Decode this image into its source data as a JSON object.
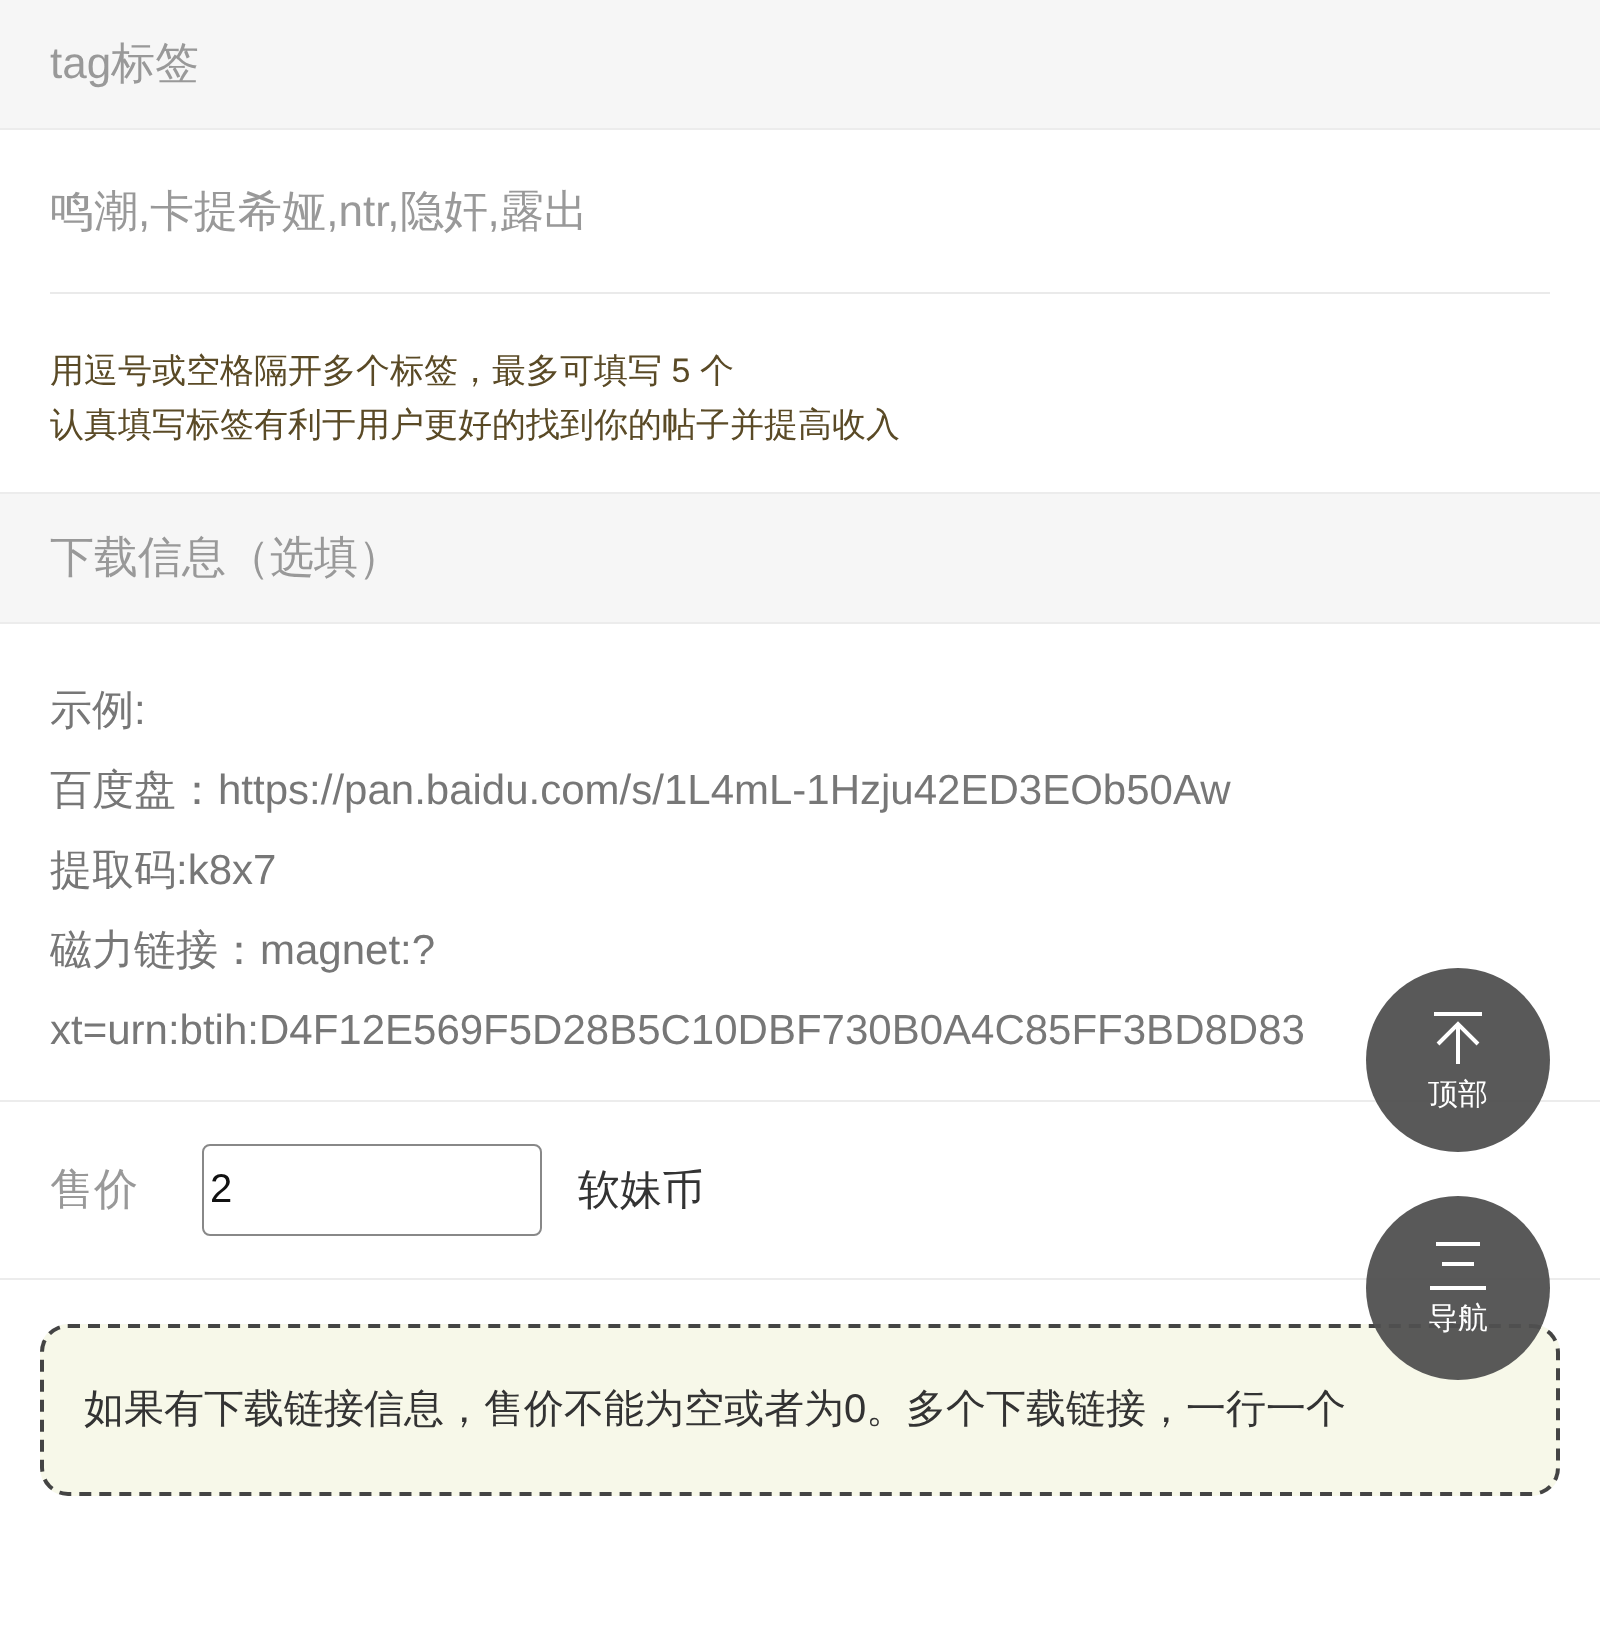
{
  "tag_section": {
    "title": "tag标签",
    "field": {
      "value": "鸣潮,卡提希娅,ntr,隐奸,露出"
    },
    "hint_lines": [
      "用逗号或空格隔开多个标签，最多可填写 5 个",
      "认真填写标签有利于用户更好的找到你的帖子并提高收入"
    ]
  },
  "download_section": {
    "title": "下载信息（选填）",
    "example_lines": [
      "示例:",
      "百度盘：https://pan.baidu.com/s/1L4mL-1Hzju42ED3EOb50Aw",
      "提取码:k8x7",
      "磁力链接：magnet:?",
      "xt=urn:btih:D4F12E569F5D28B5C10DBF730B0A4C85FF3BD8D83"
    ]
  },
  "price": {
    "label": "售价",
    "value": "2",
    "unit": "软妹币"
  },
  "notice": "如果有下载链接信息，售价不能为空或者为0。多个下载链接，一行一个",
  "float_buttons": [
    {
      "kind": "top",
      "label": "顶部"
    },
    {
      "kind": "nav",
      "label": "导航"
    }
  ]
}
